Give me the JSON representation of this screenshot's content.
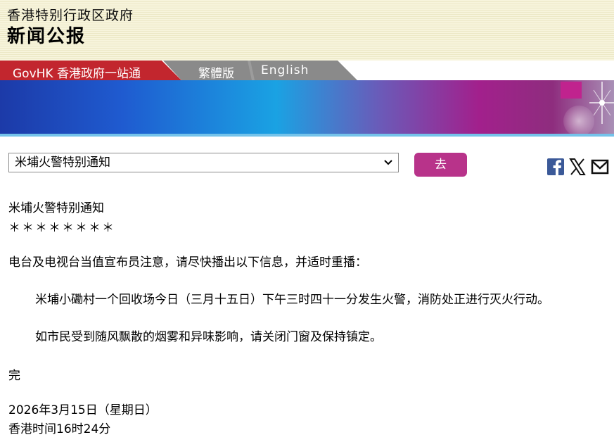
{
  "header": {
    "org_title": "香港特别行政区政府",
    "page_title": "新闻公报"
  },
  "nav": {
    "govhk": "GovHK 香港政府一站通",
    "traditional": "繁體版",
    "english": "English"
  },
  "controls": {
    "select_value": "米埔火警特别通知",
    "go_label": "去"
  },
  "share": {
    "facebook_icon": "facebook-icon",
    "x_icon": "x-icon",
    "mail_icon": "mail-icon"
  },
  "article": {
    "title": "米埔火警特别通知",
    "stars": "＊＊＊＊＊＊＊＊",
    "notice": "电台及电视台当值宣布员注意，请尽快播出以下信息，并适时重播：",
    "para1": "米埔小磡村一个回收场今日（三月十五日）下午三时四十一分发生火警，消防处正进行灭火行动。",
    "para2": "如市民受到随风飘散的烟雾和异味影响，请关闭门窗及保持镇定。",
    "end": "完",
    "date": "2026年3月15日（星期日）",
    "time": "香港时间16时24分"
  },
  "colors": {
    "govhk_tab": "#c2262e",
    "grey_tab": "#8a8a8a",
    "go_button": "#b8338a",
    "facebook": "#3b5998"
  }
}
